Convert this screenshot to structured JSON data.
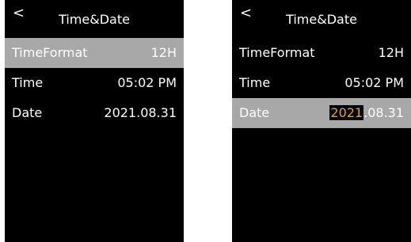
{
  "screens": [
    {
      "title": "Time&Date",
      "back_symbol": "<",
      "rows": [
        {
          "label": "TimeFormat",
          "value": "12H"
        },
        {
          "label": "Time",
          "value": "05:02 PM"
        },
        {
          "label": "Date",
          "value": "2021.08.31"
        }
      ],
      "selected_row": "TimeFormat"
    },
    {
      "title": "Time&Date",
      "back_symbol": "<",
      "rows": [
        {
          "label": "TimeFormat",
          "value": "12H"
        },
        {
          "label": "Time",
          "value": "05:02 PM"
        },
        {
          "label": "Date",
          "value_year": "2021",
          "value_rest": ".08.31"
        }
      ],
      "selected_row": "Date",
      "editing_field": "year"
    }
  ],
  "colors": {
    "screen_background": "#000000",
    "selection_highlight": "#a8a8a8",
    "editing_year_text": "#f0a020",
    "text": "#ffffff"
  }
}
